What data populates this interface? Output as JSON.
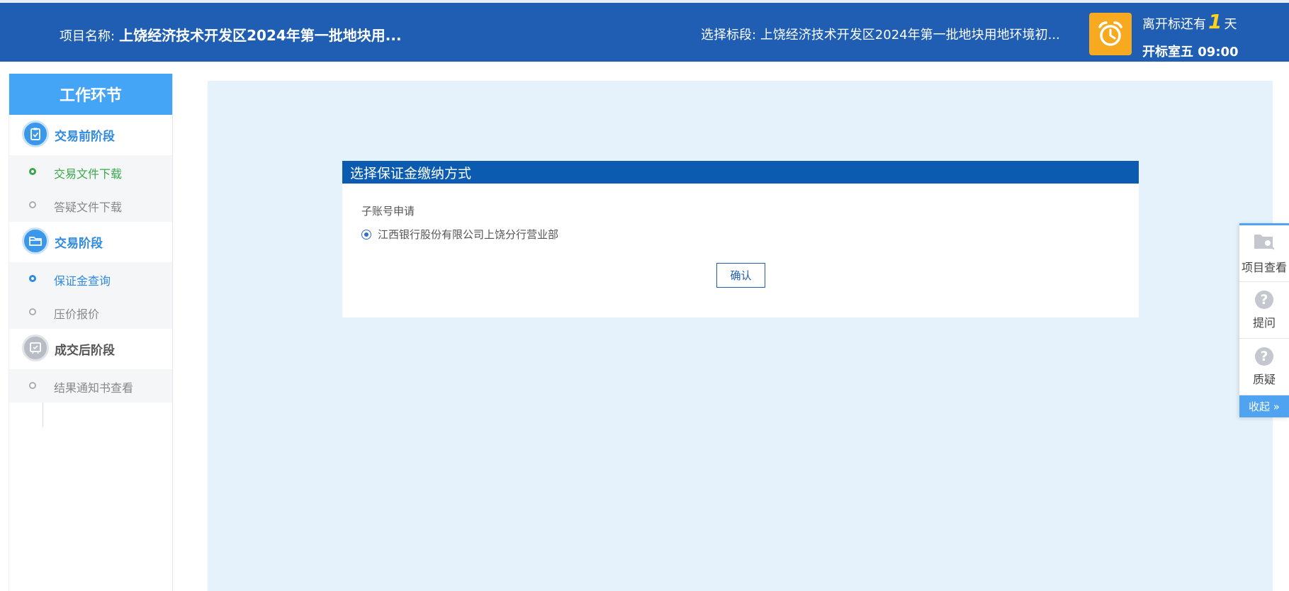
{
  "header": {
    "project_label": "项目名称:",
    "project_name": "上饶经济技术开发区2024年第一批地块用...",
    "section_label": "选择标段:",
    "section_name": "上饶经济技术开发区2024年第一批地块用地环境初...",
    "countdown_prefix": "离开标还有",
    "countdown_days": "1",
    "countdown_suffix": "天",
    "open_time": "开标室五 09:00",
    "alarm_icon": "alarm-clock-icon",
    "colors": {
      "header_bg": "#1f5eb2",
      "alarm_bg": "#f7a91f",
      "days_color": "#ffd21e"
    }
  },
  "sidebar": {
    "title": "工作环节",
    "stages": [
      {
        "label": "交易前阶段",
        "icon": "document-check-icon",
        "items": [
          {
            "label": "交易文件下载",
            "state": "done"
          },
          {
            "label": "答疑文件下载",
            "state": "pending"
          }
        ]
      },
      {
        "label": "交易阶段",
        "icon": "folder-icon",
        "items": [
          {
            "label": "保证金查询",
            "state": "current"
          },
          {
            "label": "压价报价",
            "state": "pending"
          }
        ]
      },
      {
        "label": "成交后阶段",
        "icon": "certificate-icon",
        "items": [
          {
            "label": "结果通知书查看",
            "state": "pending"
          }
        ]
      }
    ]
  },
  "modal": {
    "title": "选择保证金缴纳方式",
    "subheading": "子账号申请",
    "option": "江西银行股份有限公司上饶分行营业部",
    "option_selected": true,
    "confirm_label": "确认"
  },
  "float_panel": {
    "items": [
      {
        "label": "项目查看",
        "icon": "folder-search-icon"
      },
      {
        "label": "提问",
        "icon": "question-icon"
      },
      {
        "label": "质疑",
        "icon": "question-icon"
      }
    ],
    "collapse_label": "收起 »"
  }
}
